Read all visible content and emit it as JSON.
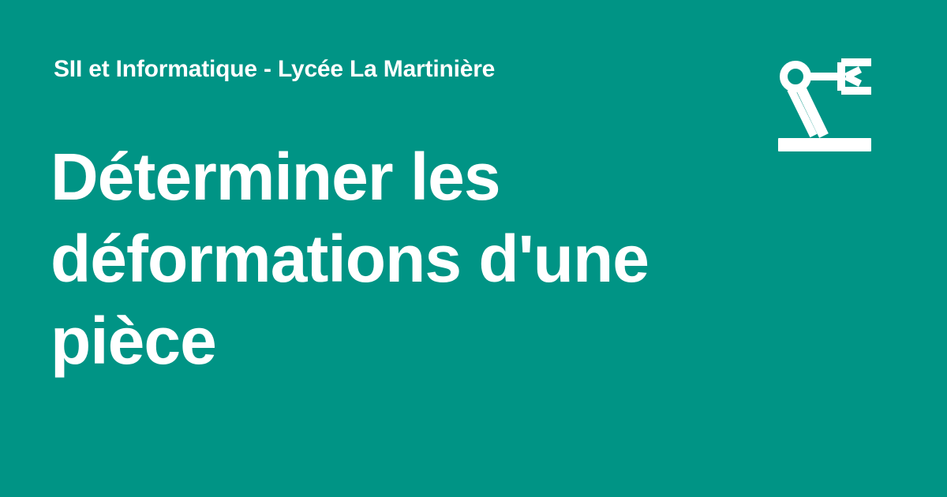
{
  "header": {
    "site_name": "SII et Informatique - Lycée La Martinière"
  },
  "main": {
    "title": "Déterminer les déformations d'une pièce"
  },
  "icons": {
    "logo": "robot-arm-icon"
  },
  "colors": {
    "background": "#009485",
    "text": "#ffffff"
  }
}
